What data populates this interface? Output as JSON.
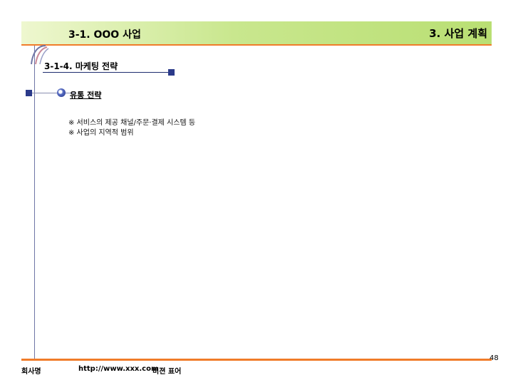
{
  "header": {
    "left_title": "3-1. OOO 사업",
    "right_title": "3. 사업 계획"
  },
  "section": {
    "title": "3-1-4. 마케팅 전략"
  },
  "bullet": {
    "label": "유통 전략"
  },
  "notes": [
    "※ 서비스의 제공 채널/주문·결제 시스템 등",
    "※ 사업의 지역적 범위"
  ],
  "footer": {
    "company": "회사명",
    "url": "http://www.xxx.com",
    "vision": "비젼 표어",
    "page_number": "48"
  },
  "colors": {
    "header_band": "#c9e78e",
    "accent_orange": "#f07c2a",
    "accent_navy": "#2b3a8a"
  }
}
